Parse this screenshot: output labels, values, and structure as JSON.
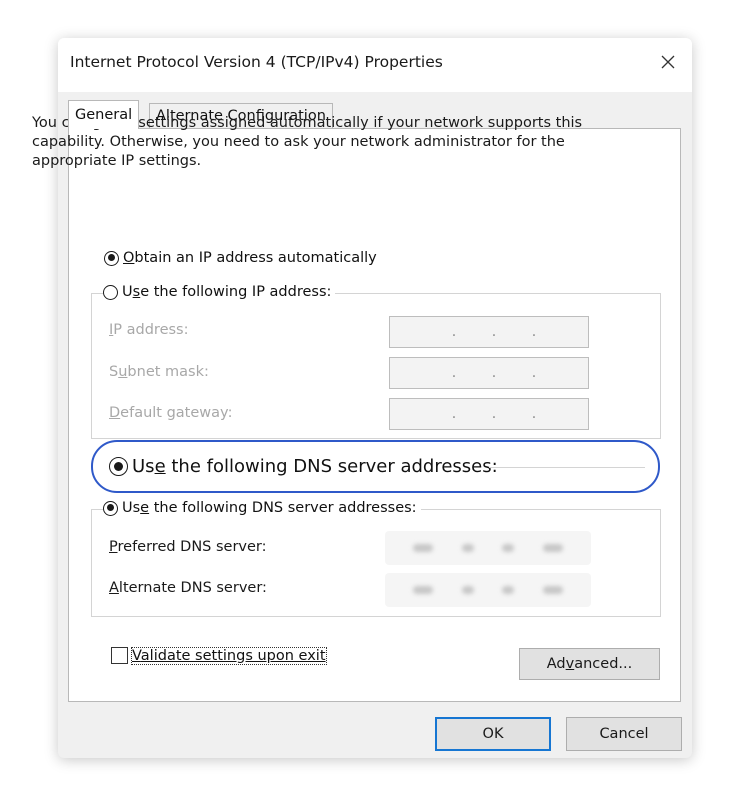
{
  "window": {
    "title": "Internet Protocol Version 4 (TCP/IPv4) Properties",
    "close_glyph": "✕"
  },
  "tabs": [
    {
      "label": "General",
      "active": true
    },
    {
      "label": "Alternate Configuration",
      "active": false
    }
  ],
  "description": "You can get IP settings assigned automatically if your network supports this capability. Otherwise, you need to ask your network administrator for the appropriate IP settings.",
  "ip_options": {
    "auto": {
      "label_ul": "O",
      "label_rest": "btain an IP address automatically",
      "checked": true
    },
    "manual": {
      "label_pre": "U",
      "label_ul": "s",
      "label_rest": "e the following IP address:",
      "checked": false
    }
  },
  "ip_fields": [
    {
      "label_ul": "I",
      "label_rest": "P address:",
      "dots": [
        ".",
        ".",
        "."
      ]
    },
    {
      "label_pre": "S",
      "label_ul": "u",
      "label_rest": "bnet mask:",
      "dots": [
        ".",
        ".",
        "."
      ]
    },
    {
      "label_ul": "D",
      "label_rest": "efault gateway:",
      "dots": [
        ".",
        ".",
        "."
      ]
    }
  ],
  "highlight_option": {
    "label_pre": "Us",
    "label_ul": "e",
    "label_rest": " the following DNS server addresses:",
    "checked": true
  },
  "dns_option": {
    "label_pre": "Us",
    "label_ul": "e",
    "label_rest": " the following DNS server addresses:",
    "checked": true
  },
  "dns_fields": [
    {
      "label_ul": "P",
      "label_rest": "referred DNS server:"
    },
    {
      "label_ul": "A",
      "label_rest": "lternate DNS server:"
    }
  ],
  "validate": {
    "label_ul": "V",
    "label_rest": "alidate settings upon exit",
    "checked": false
  },
  "buttons": {
    "advanced_pre": "Ad",
    "advanced_ul": "v",
    "advanced_rest": "anced...",
    "ok": "OK",
    "cancel": "Cancel"
  },
  "colors": {
    "highlight": "#2f59c9",
    "ok_border": "#1676d2",
    "dialog_bg": "#f0f0f0"
  }
}
